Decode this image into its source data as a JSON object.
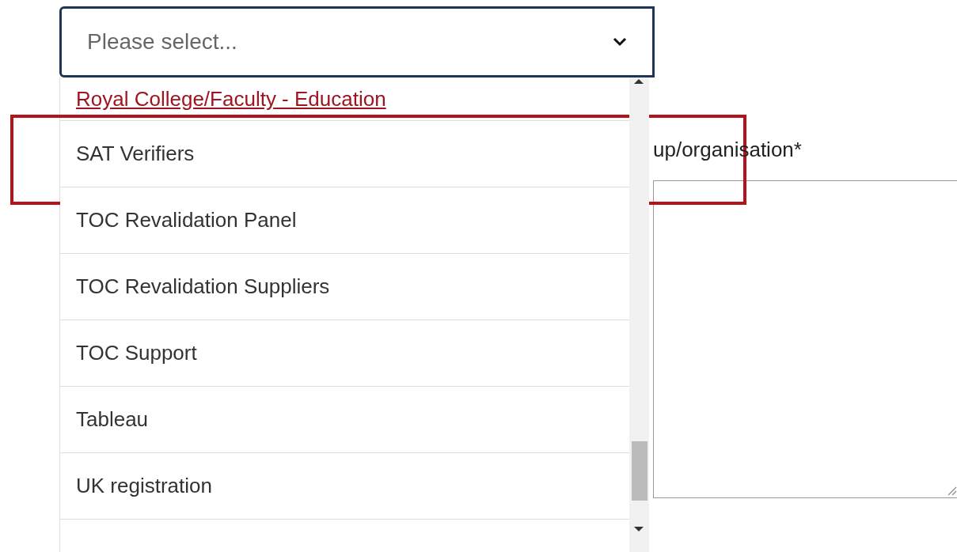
{
  "select": {
    "placeholder": "Please select..."
  },
  "options": [
    {
      "label": "Royal College/Faculty - Education",
      "highlighted": false
    },
    {
      "label": "SAT Verifiers",
      "highlighted": true
    },
    {
      "label": "TOC Revalidation Panel",
      "highlighted": false
    },
    {
      "label": "TOC Revalidation Suppliers",
      "highlighted": false
    },
    {
      "label": "TOC Support",
      "highlighted": false
    },
    {
      "label": "Tableau",
      "highlighted": false
    },
    {
      "label": "UK registration",
      "highlighted": false
    }
  ],
  "background_field": {
    "label": "up/organisation*"
  }
}
